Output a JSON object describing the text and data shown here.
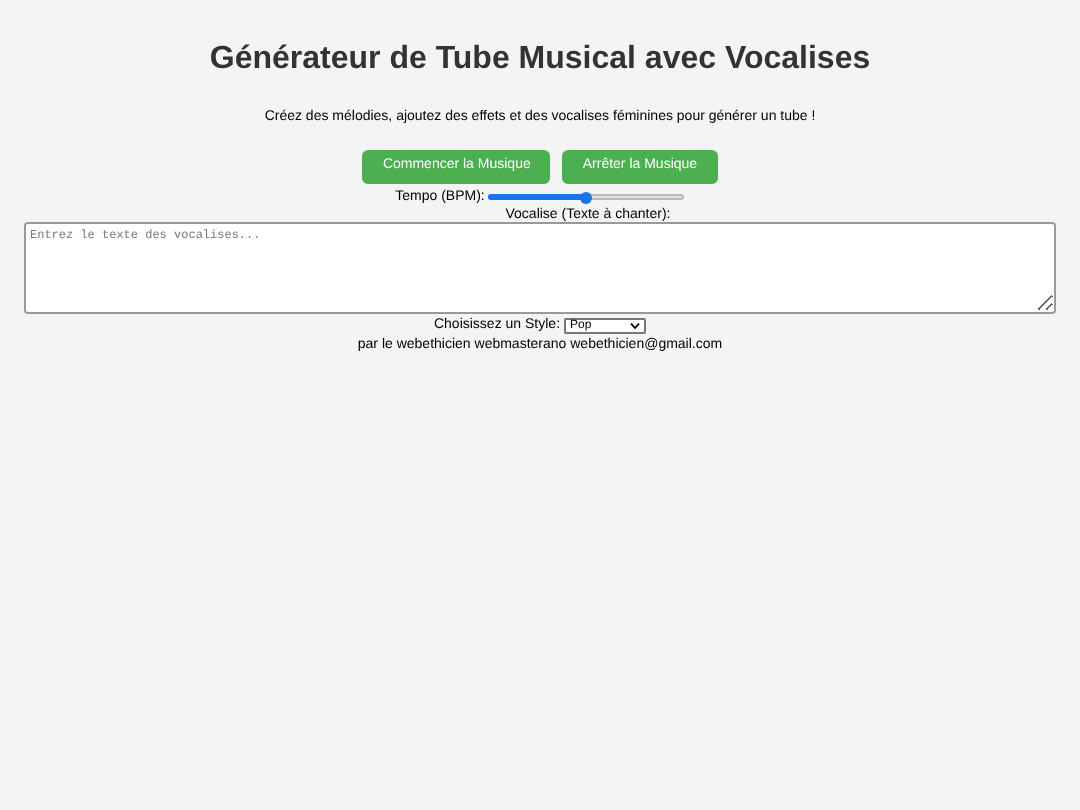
{
  "title": "Générateur de Tube Musical avec Vocalises",
  "subtitle": "Créez des mélodies, ajoutez des effets et des vocalises féminines pour générer un tube !",
  "buttons": [
    {
      "label": "Commencer la Musique"
    },
    {
      "label": "Arrêter la Musique"
    }
  ],
  "tempo": {
    "label": "Tempo (BPM):",
    "level": 0.5
  },
  "vocalise": {
    "label": "Vocalise (Texte à chanter):",
    "placeholder": "Entrez le texte des vocalises..."
  },
  "style": {
    "label": "Choisissez un Style:",
    "value": "Pop"
  },
  "footer": "par le webethicien webmasterano webethicien@gmail.com"
}
